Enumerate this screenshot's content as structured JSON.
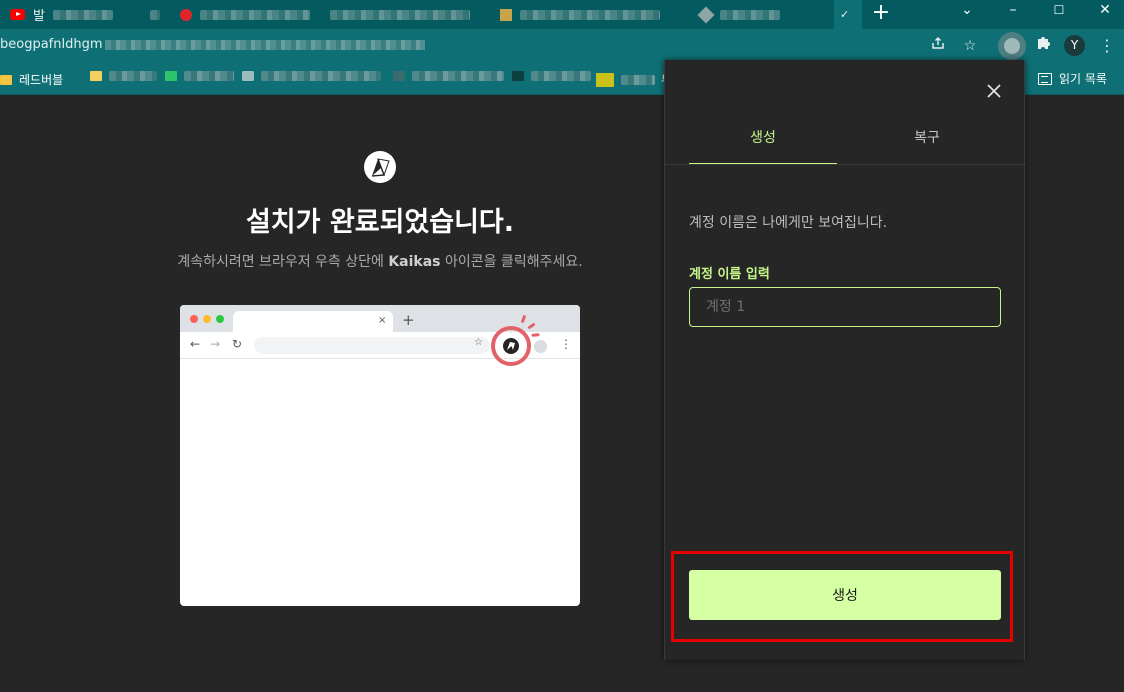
{
  "browser": {
    "tabs": [
      {
        "label": "발",
        "close": ""
      },
      {
        "label": ""
      },
      {
        "label": ""
      },
      {
        "label": ""
      },
      {
        "label": ""
      },
      {
        "label": ""
      },
      {
        "label": "",
        "close": "✓"
      }
    ],
    "new_tab": "+",
    "window_controls": {
      "dropdown": "⌄",
      "minimize": "–",
      "maximize": "☐",
      "close": "✕"
    },
    "url": "beogpafnldhgm",
    "avatar_initial": "Y",
    "bookmarks": [
      {
        "label": "레드버블"
      },
      {
        "label": "뷰"
      }
    ],
    "reading_list": "읽기 목록"
  },
  "main": {
    "headline": "설치가 완료되었습니다.",
    "subline_before": "계속하시려면 브라우저 우측 상단에 ",
    "subline_brand": "Kaikas",
    "subline_after": " 아이콘을 클릭해주세요."
  },
  "popup": {
    "tabs": [
      {
        "label": "생성",
        "active": true
      },
      {
        "label": "복구",
        "active": false
      }
    ],
    "description": "계정 이름은 나에게만 보여집니다.",
    "field_label": "계정 이름 입력",
    "field_placeholder": "계정 1",
    "create_button": "생성",
    "accent_color": "#c6f589",
    "button_color": "#d5ffa3"
  },
  "highlight_color": "#e60000"
}
